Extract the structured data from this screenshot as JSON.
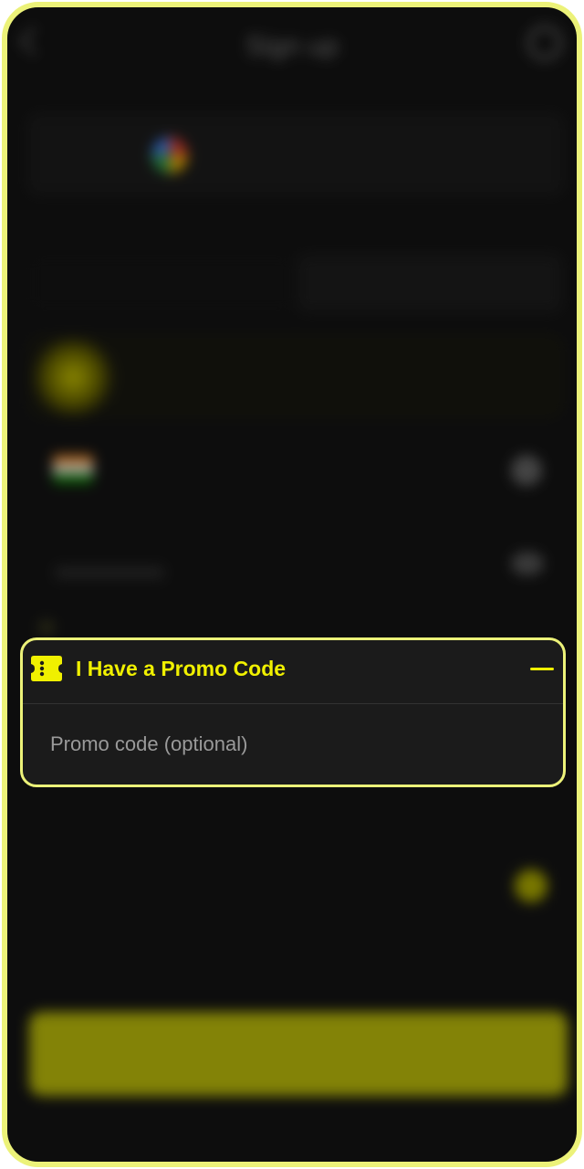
{
  "header": {
    "title": "Sign up",
    "back_icon": "chevron-left-icon",
    "support_icon": "headset-icon"
  },
  "promo": {
    "title": "I Have a Promo Code",
    "placeholder": "Promo code (optional)",
    "value": "",
    "expanded": true,
    "icon": "ticket-icon",
    "collapse_icon": "minus-icon"
  },
  "colors": {
    "accent": "#f0f000",
    "frame": "#ecf279",
    "background": "#151515"
  }
}
